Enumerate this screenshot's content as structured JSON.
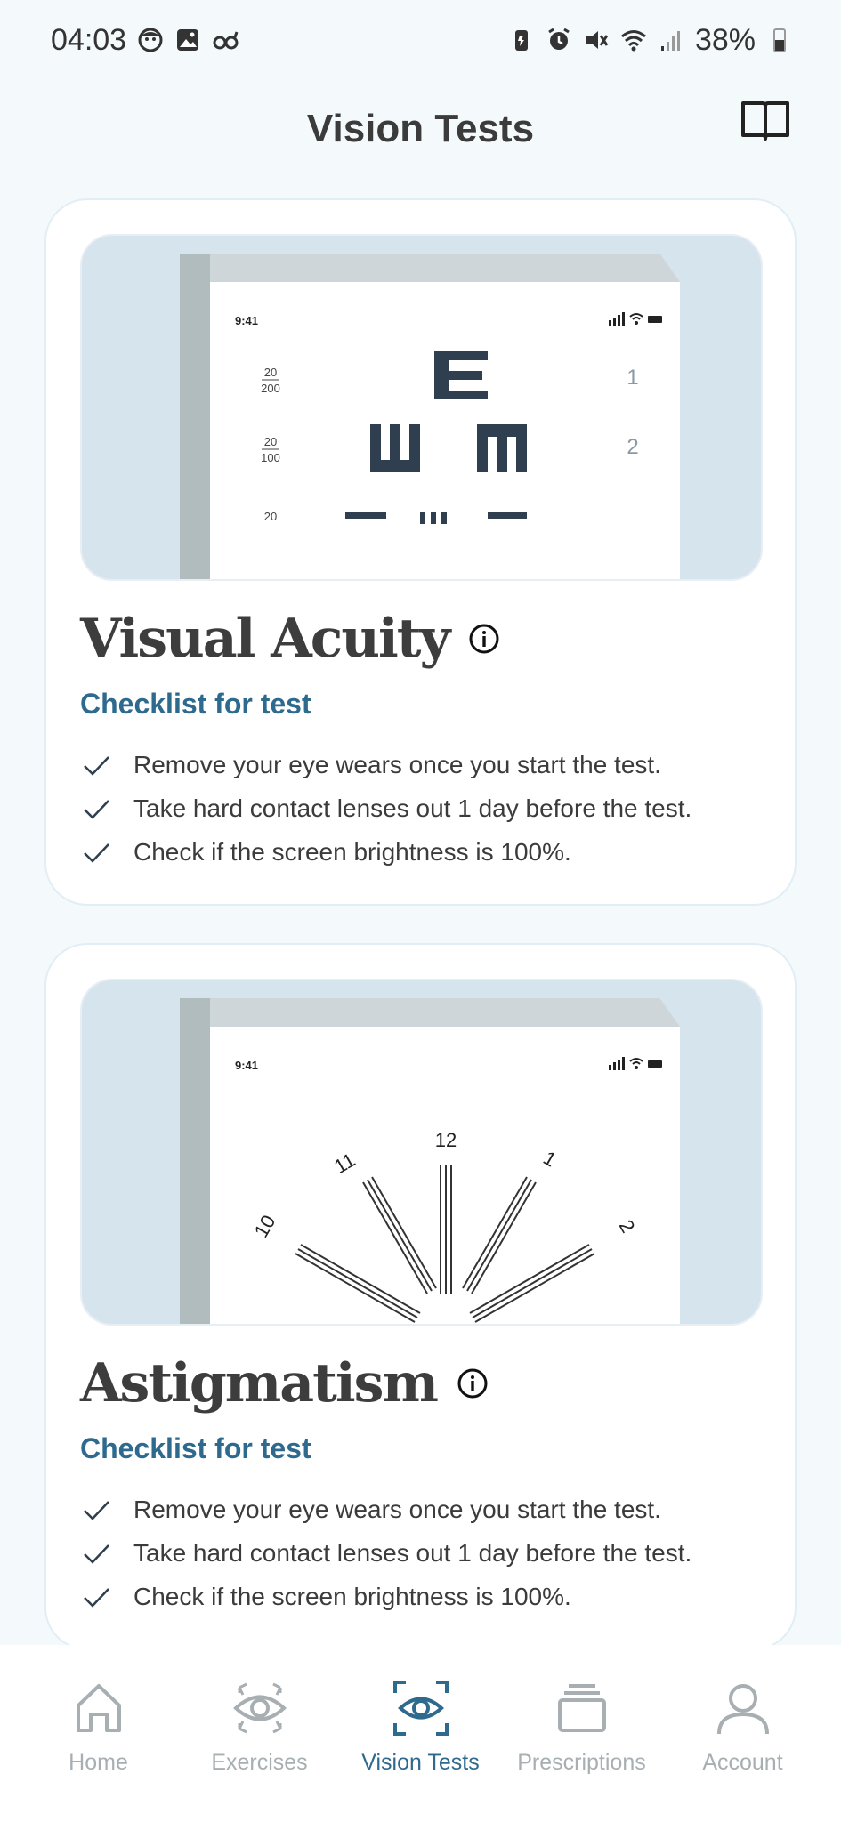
{
  "status_bar": {
    "time": "04:03",
    "battery": "38%"
  },
  "header": {
    "title": "Vision Tests",
    "book_icon": "book-open-icon"
  },
  "cards": [
    {
      "title": "Visual Acuity",
      "subtitle": "Checklist for test",
      "illustration": {
        "time": "9:41",
        "rows": [
          {
            "fraction_top": "20",
            "fraction_bottom": "200",
            "number": "1"
          },
          {
            "fraction_top": "20",
            "fraction_bottom": "100",
            "number": "2"
          },
          {
            "fraction_top": "20"
          }
        ]
      },
      "checklist": [
        "Remove your eye wears once you start the test.",
        "Take hard contact lenses out 1 day before the test.",
        "Check if the screen brightness is 100%."
      ]
    },
    {
      "title": "Astigmatism",
      "subtitle": "Checklist for test",
      "illustration": {
        "time": "9:41",
        "dial_numbers": [
          "10",
          "11",
          "12",
          "1",
          "2"
        ]
      },
      "checklist": [
        "Remove your eye wears once you start the test.",
        "Take hard contact lenses out 1 day before the test.",
        "Check if the screen brightness is 100%."
      ]
    }
  ],
  "bottom_nav": [
    {
      "label": "Home",
      "icon": "home-icon",
      "active": false
    },
    {
      "label": "Exercises",
      "icon": "eye-exercise-icon",
      "active": false
    },
    {
      "label": "Vision Tests",
      "icon": "eye-scan-icon",
      "active": true
    },
    {
      "label": "Prescriptions",
      "icon": "stack-icon",
      "active": false
    },
    {
      "label": "Account",
      "icon": "user-icon",
      "active": false
    }
  ],
  "colors": {
    "accent": "#2e6a8e",
    "background": "#f4f9fc",
    "inactive": "#a8afb3"
  }
}
